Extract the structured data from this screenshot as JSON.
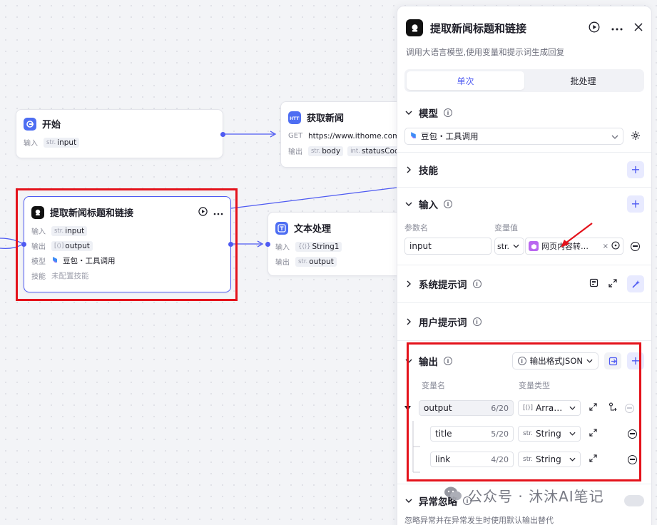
{
  "nodes": {
    "start": {
      "title": "开始",
      "input_label": "输入",
      "input_type": "str.",
      "input_name": "input"
    },
    "fetch": {
      "title": "获取新闻",
      "method": "GET",
      "url": "https://www.ithome.com/se",
      "output_label": "输出",
      "out1_type": "str.",
      "out1_name": "body",
      "out2_type": "int.",
      "out2_name": "statusCode"
    },
    "llm": {
      "title": "提取新闻标题和链接",
      "input_label": "输入",
      "input_type": "str.",
      "input_name": "input",
      "output_label": "输出",
      "output_type": "[⟨⟩]",
      "output_name": "output",
      "model_label": "模型",
      "model_name": "豆包・工具调用",
      "skill_label": "技能",
      "skill_value": "未配置技能"
    },
    "text": {
      "title": "文本处理",
      "input_label": "输入",
      "input_type": "{⟨⟩}",
      "input_name": "String1",
      "output_label": "输出",
      "output_type": "str.",
      "output_name": "output"
    }
  },
  "panel": {
    "title": "提取新闻标题和链接",
    "description": "调用大语言模型,使用变量和提示词生成回复",
    "tabs": [
      "单次",
      "批处理"
    ],
    "model": {
      "title": "模型",
      "selected": "豆包・工具调用"
    },
    "skills": {
      "title": "技能"
    },
    "input": {
      "title": "输入",
      "col_name": "参数名",
      "col_value": "变量值",
      "param_name": "input",
      "type_short": "str.",
      "ref_value": "网页内容转…"
    },
    "system_prompt": {
      "title": "系统提示词"
    },
    "user_prompt": {
      "title": "用户提示词"
    },
    "output": {
      "title": "输出",
      "format": "输出格式JSON",
      "col_name": "变量名",
      "col_type": "变量类型",
      "rows": [
        {
          "name": "output",
          "count": "6/20",
          "type_prefix": "[⟨⟩]",
          "type": "Arra…"
        },
        {
          "name": "title",
          "count": "5/20",
          "type_prefix": "str.",
          "type": "String"
        },
        {
          "name": "link",
          "count": "4/20",
          "type_prefix": "str.",
          "type": "String"
        }
      ]
    },
    "exception": {
      "title": "异常忽略",
      "desc": "忽略异常并在异常发生时使用默认输出替代"
    }
  },
  "watermark": "公众号 · 沐沐AI笔记",
  "colors": {
    "accent": "#4e5af2",
    "annotation": "#e4121b",
    "edge": "#4e5af2"
  }
}
